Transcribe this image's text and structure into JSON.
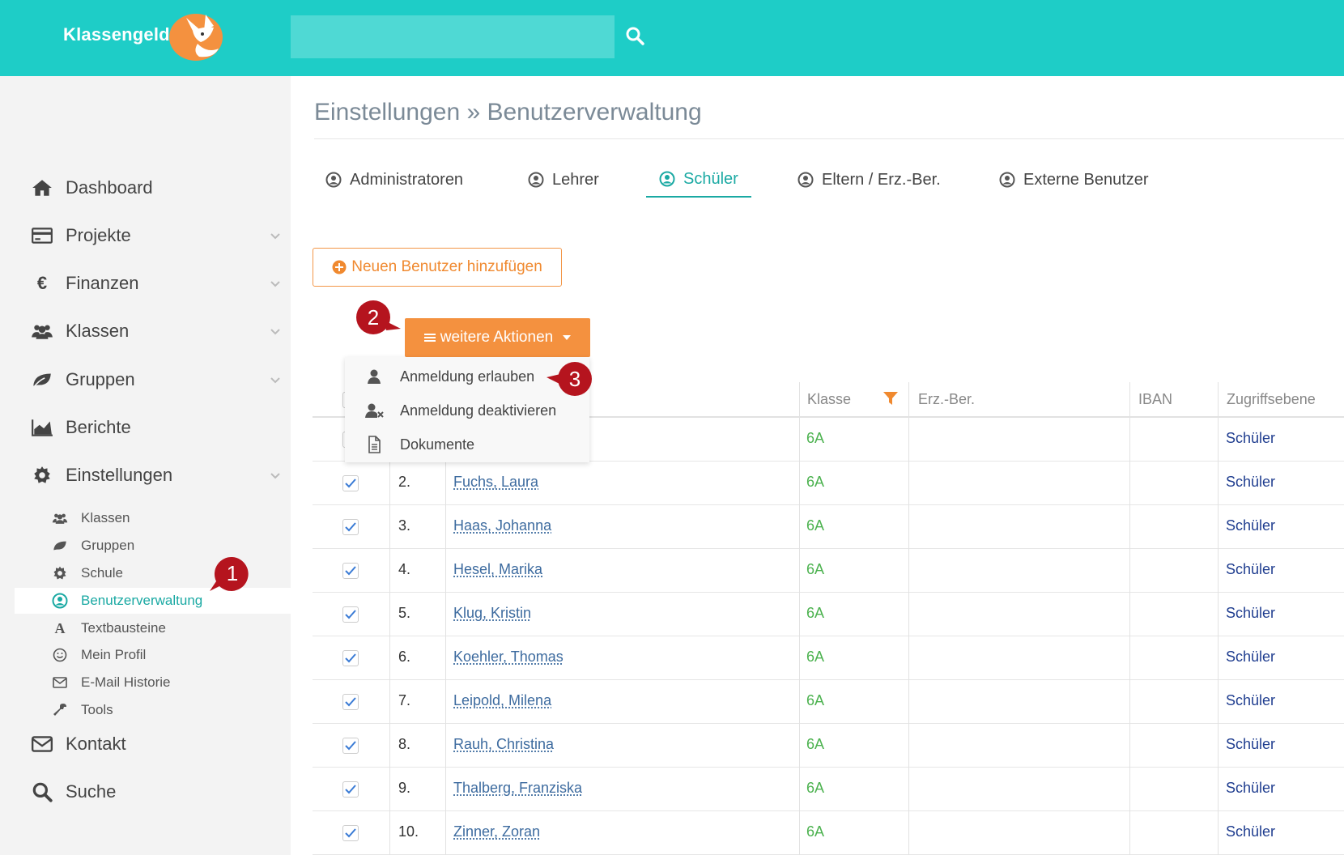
{
  "header": {
    "logo_text": "Klassengeld",
    "search_placeholder": ""
  },
  "sidebar": {
    "items": [
      {
        "label": "Dashboard",
        "icon": "home-icon"
      },
      {
        "label": "Projekte",
        "icon": "credit-card-icon"
      },
      {
        "label": "Finanzen",
        "icon": "euro-icon"
      },
      {
        "label": "Klassen",
        "icon": "users-icon"
      },
      {
        "label": "Gruppen",
        "icon": "leaf-icon"
      },
      {
        "label": "Berichte",
        "icon": "area-chart-icon"
      },
      {
        "label": "Einstellungen",
        "icon": "gear-icon"
      },
      {
        "label": "Kontakt",
        "icon": "envelope-icon"
      },
      {
        "label": "Suche",
        "icon": "search-icon"
      }
    ],
    "sub_items": [
      {
        "label": "Klassen",
        "icon": "users-icon"
      },
      {
        "label": "Gruppen",
        "icon": "leaf-icon"
      },
      {
        "label": "Schule",
        "icon": "gear-icon"
      },
      {
        "label": "Benutzerverwaltung",
        "icon": "user-circle-icon",
        "active": true
      },
      {
        "label": "Textbausteine",
        "icon": "font-icon"
      },
      {
        "label": "Mein Profil",
        "icon": "smiley-icon"
      },
      {
        "label": "E-Mail Historie",
        "icon": "envelope-icon"
      },
      {
        "label": "Tools",
        "icon": "wrench-icon"
      }
    ]
  },
  "main": {
    "breadcrumb": "Einstellungen » Benutzerverwaltung",
    "tabs": [
      {
        "label": "Administratoren"
      },
      {
        "label": "Lehrer"
      },
      {
        "label": "Schüler",
        "active": true
      },
      {
        "label": "Eltern / Erz.-Ber."
      },
      {
        "label": "Externe Benutzer"
      }
    ],
    "add_user_label": "Neuen Benutzer hinzufügen",
    "actions_label": "weitere Aktionen",
    "dropdown": [
      {
        "label": "Anmeldung erlauben",
        "icon": "user-icon"
      },
      {
        "label": "Anmeldung deaktivieren",
        "icon": "user-times-icon"
      },
      {
        "label": "Dokumente",
        "icon": "document-icon"
      }
    ],
    "table": {
      "headers": {
        "klasse": "Klasse",
        "erz": "Erz.-Ber.",
        "iban": "IBAN",
        "zugriff": "Zugriffsebene"
      },
      "rows": [
        {
          "num": "",
          "name": "",
          "klasse": "6A",
          "zugriff": "Schüler"
        },
        {
          "num": "2.",
          "name": "Fuchs, Laura",
          "klasse": "6A",
          "zugriff": "Schüler"
        },
        {
          "num": "3.",
          "name": "Haas, Johanna",
          "klasse": "6A",
          "zugriff": "Schüler"
        },
        {
          "num": "4.",
          "name": "Hesel, Marika",
          "klasse": "6A",
          "zugriff": "Schüler"
        },
        {
          "num": "5.",
          "name": "Klug, Kristin",
          "klasse": "6A",
          "zugriff": "Schüler"
        },
        {
          "num": "6.",
          "name": "Koehler, Thomas",
          "klasse": "6A",
          "zugriff": "Schüler"
        },
        {
          "num": "7.",
          "name": "Leipold, Milena",
          "klasse": "6A",
          "zugriff": "Schüler"
        },
        {
          "num": "8.",
          "name": "Rauh, Christina",
          "klasse": "6A",
          "zugriff": "Schüler"
        },
        {
          "num": "9.",
          "name": "Thalberg, Franziska",
          "klasse": "6A",
          "zugriff": "Schüler"
        },
        {
          "num": "10.",
          "name": "Zinner, Zoran",
          "klasse": "6A",
          "zugriff": "Schüler"
        }
      ]
    }
  },
  "callouts": [
    "1",
    "2",
    "3"
  ],
  "colors": {
    "teal": "#1ecdc7",
    "orange": "#f4913f",
    "callout_red": "#b5141e",
    "green": "#4cb24f",
    "navy": "#1f3d8f"
  }
}
